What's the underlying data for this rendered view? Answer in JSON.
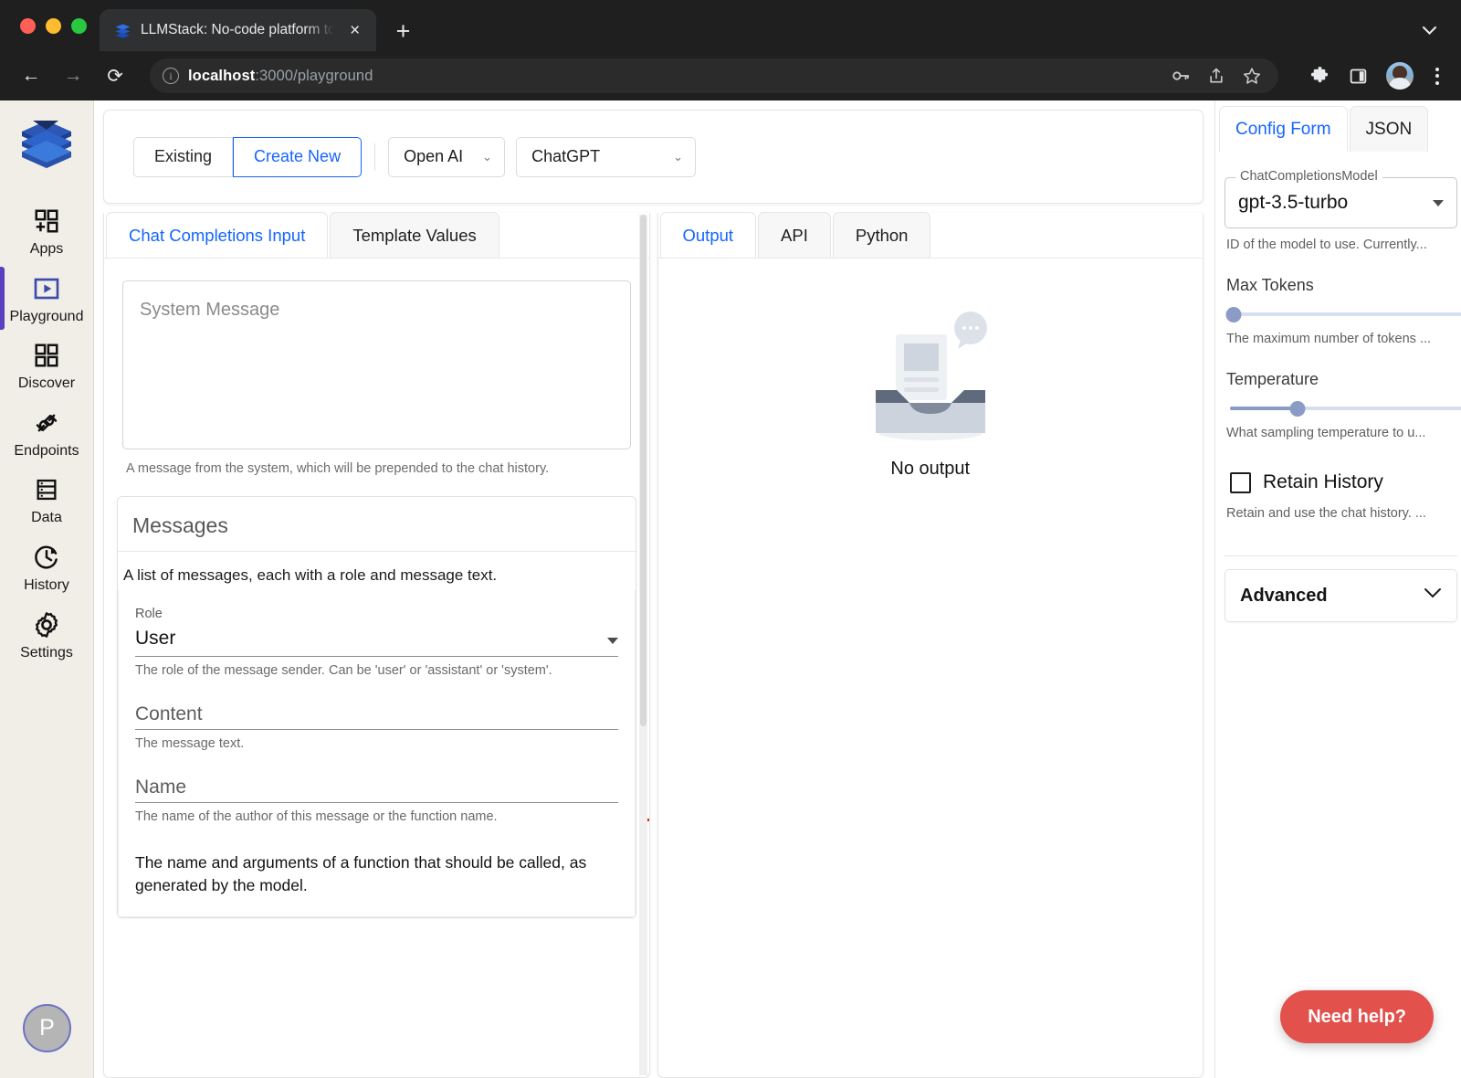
{
  "browser": {
    "tab": {
      "title": "LLMStack: No-code platform to",
      "favicon": "llmstack-layers-icon",
      "close": "×"
    },
    "new_tab": "+",
    "tab_search_icon": "chevron-down-icon",
    "nav": {
      "back": "←",
      "forward": "→",
      "reload": "⟳"
    },
    "omnibox": {
      "info_icon": "info-circle-icon",
      "url_host": "localhost",
      "url_rest": ":3000/playground"
    },
    "actions": [
      "key-icon",
      "share-icon",
      "star-icon",
      "extensions-puzzle-icon",
      "side-panel-icon",
      "profile-avatar",
      "kebab-menu-icon"
    ]
  },
  "sidebar": {
    "logo": "llmstack-logo",
    "items": [
      {
        "label": "Apps",
        "icon": "apps-add-icon",
        "active": false
      },
      {
        "label": "Playground",
        "icon": "play-square-icon",
        "active": true
      },
      {
        "label": "Discover",
        "icon": "grid-four-icon",
        "active": false
      },
      {
        "label": "Endpoints",
        "icon": "plug-connect-icon",
        "active": false
      },
      {
        "label": "Data",
        "icon": "database-rows-icon",
        "active": false
      },
      {
        "label": "History",
        "icon": "clock-history-icon",
        "active": false
      },
      {
        "label": "Settings",
        "icon": "gear-icon",
        "active": false
      }
    ],
    "avatar_initial": "P"
  },
  "toolbar": {
    "mode_existing": "Existing",
    "mode_create_new": "Create New",
    "active_mode": "Create New",
    "provider": "Open AI",
    "model": "ChatGPT",
    "chevron": "⌄"
  },
  "input_pane": {
    "tabs": [
      {
        "label": "Chat Completions Input",
        "active": true
      },
      {
        "label": "Template Values",
        "active": false
      }
    ],
    "system_message_placeholder": "System Message",
    "system_message_value": "",
    "system_message_help": "A message from the system, which will be prepended to the chat history.",
    "messages": {
      "title": "Messages",
      "description": "A list of messages, each with a role and message text.",
      "role_label": "Role",
      "role_value": "User",
      "role_help": "The role of the message sender. Can be 'user' or 'assistant' or 'system'.",
      "content_label": "Content",
      "content_value": "",
      "content_help": "The message text.",
      "name_label": "Name",
      "name_value": "",
      "name_help": "The name of the author of this message or the function name.",
      "function_call_text": "The name and arguments of a function that should be called, as generated by the model.",
      "remove_icon": "remove-dash-icon"
    }
  },
  "output_pane": {
    "tabs": [
      {
        "label": "Output",
        "active": true
      },
      {
        "label": "API",
        "active": false
      },
      {
        "label": "Python",
        "active": false
      }
    ],
    "empty_icon": "empty-inbox-icon",
    "empty_label": "No output"
  },
  "config": {
    "tabs": [
      {
        "label": "Config Form",
        "active": true
      },
      {
        "label": "JSON",
        "active": false
      }
    ],
    "model_field": {
      "legend": "ChatCompletionsModel",
      "value": "gpt-3.5-turbo",
      "help": "ID of the model to use. Currently..."
    },
    "max_tokens": {
      "label": "Max Tokens",
      "percent": 0,
      "help": "The maximum number of tokens ..."
    },
    "temperature": {
      "label": "Temperature",
      "percent": 34,
      "help": "What sampling temperature to u..."
    },
    "retain_history": {
      "label": "Retain History",
      "checked": false,
      "help": "Retain and use the chat history. ..."
    },
    "advanced": {
      "label": "Advanced",
      "chevron": "⌄"
    }
  },
  "help_fab": {
    "label": "Need help?",
    "color": "#e2514c"
  }
}
